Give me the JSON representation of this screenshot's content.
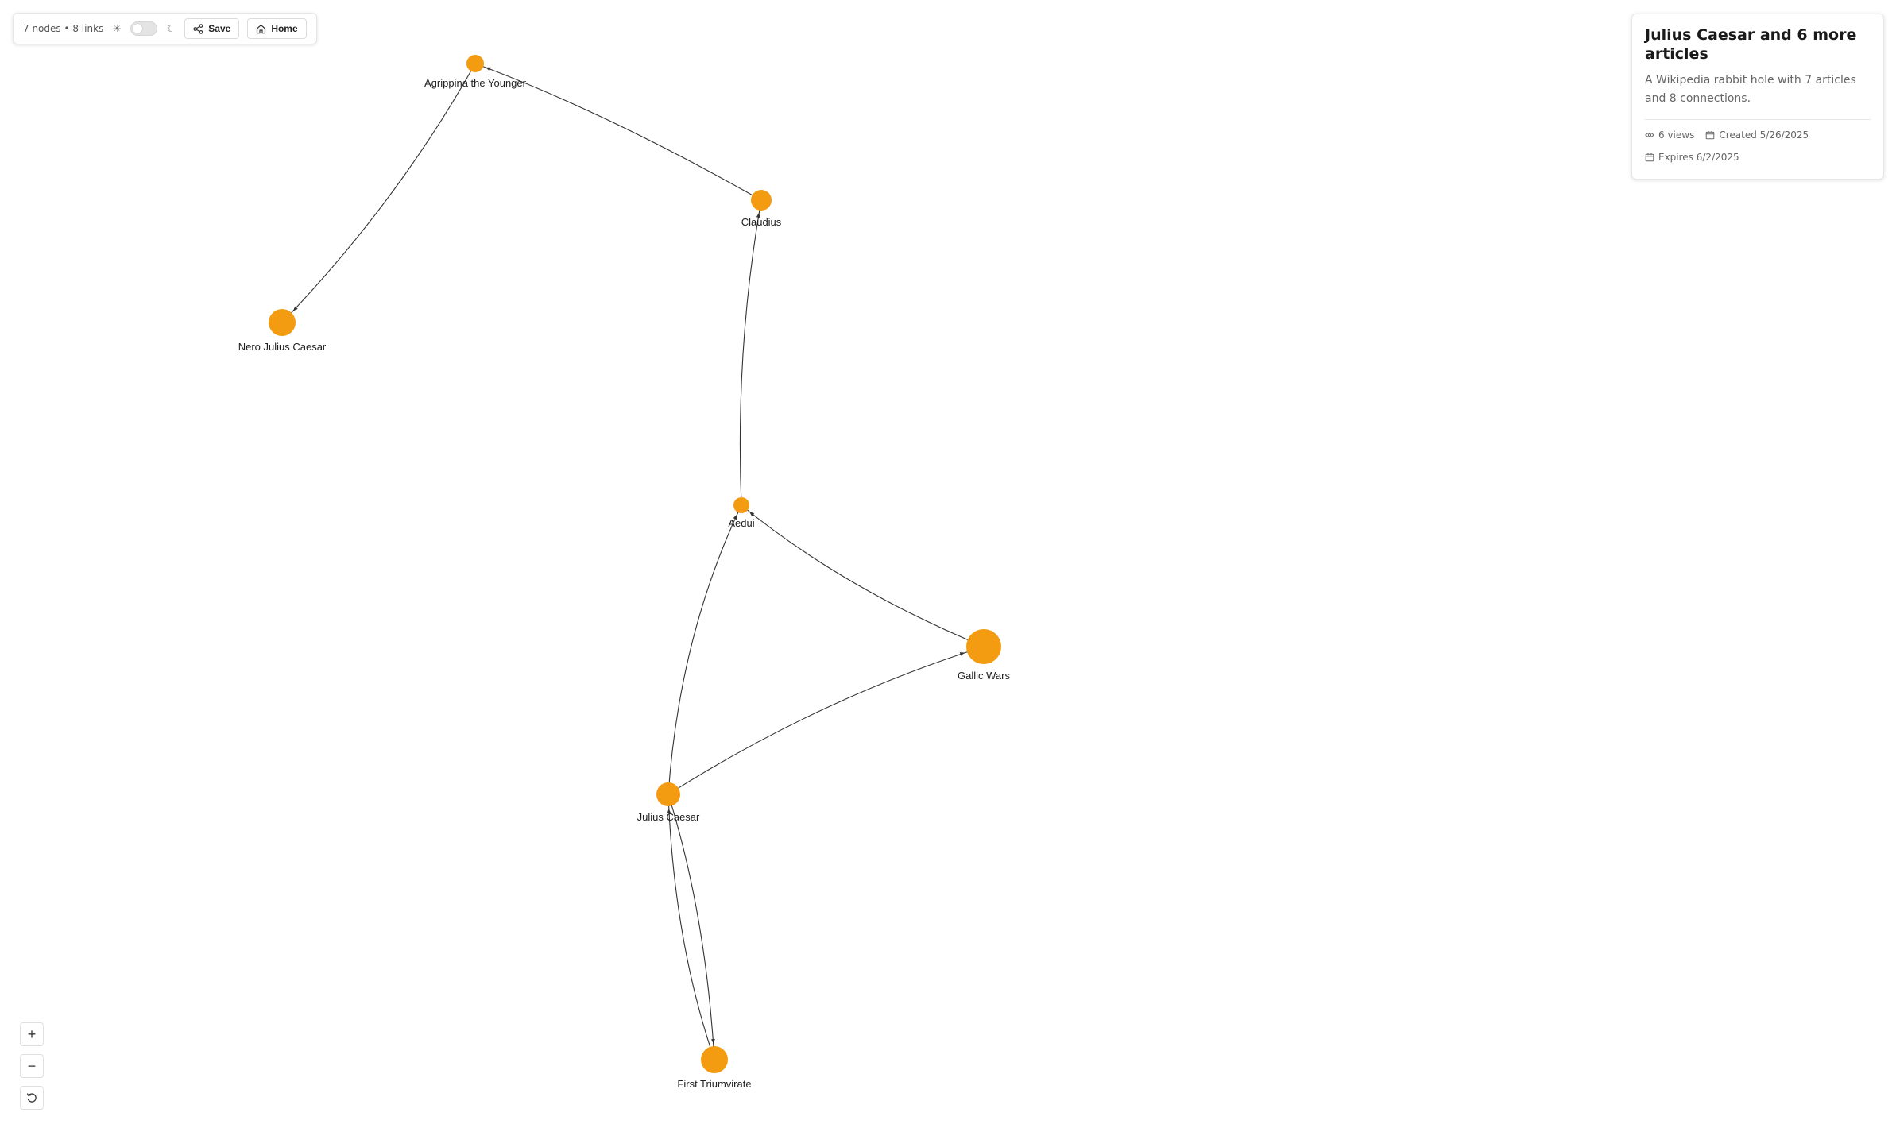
{
  "toolbar": {
    "stats": "7 nodes • 8 links",
    "light_icon": "sun-icon",
    "dark_icon": "moon-icon",
    "save_label": "Save",
    "home_label": "Home"
  },
  "info": {
    "title": "Julius Caesar and 6 more articles",
    "description": "A Wikipedia rabbit hole with 7 articles and 8 connections.",
    "views": "6 views",
    "created": "Created 5/26/2025",
    "expires": "Expires 6/2/2025"
  },
  "zoom": {
    "in_label": "+",
    "out_label": "−",
    "reset_icon": "reset-icon"
  },
  "colors": {
    "node": "#F39C12",
    "edge": "#333333",
    "label": "#222222"
  },
  "graph": {
    "nodes": [
      {
        "id": "agrippina",
        "label": "Agrippina the Younger"
      },
      {
        "id": "claudius",
        "label": "Claudius"
      },
      {
        "id": "nero",
        "label": "Nero Julius Caesar"
      },
      {
        "id": "aedui",
        "label": "Aedui"
      },
      {
        "id": "gallic",
        "label": "Gallic Wars"
      },
      {
        "id": "caesar",
        "label": "Julius Caesar"
      },
      {
        "id": "triumvirate",
        "label": "First Triumvirate"
      }
    ],
    "edges": [
      {
        "from": "agrippina",
        "to": "nero"
      },
      {
        "from": "claudius",
        "to": "agrippina"
      },
      {
        "from": "aedui",
        "to": "claudius"
      },
      {
        "from": "caesar",
        "to": "aedui"
      },
      {
        "from": "gallic",
        "to": "aedui"
      },
      {
        "from": "caesar",
        "to": "gallic"
      },
      {
        "from": "caesar",
        "to": "triumvirate"
      },
      {
        "from": "triumvirate",
        "to": "caesar"
      }
    ]
  }
}
